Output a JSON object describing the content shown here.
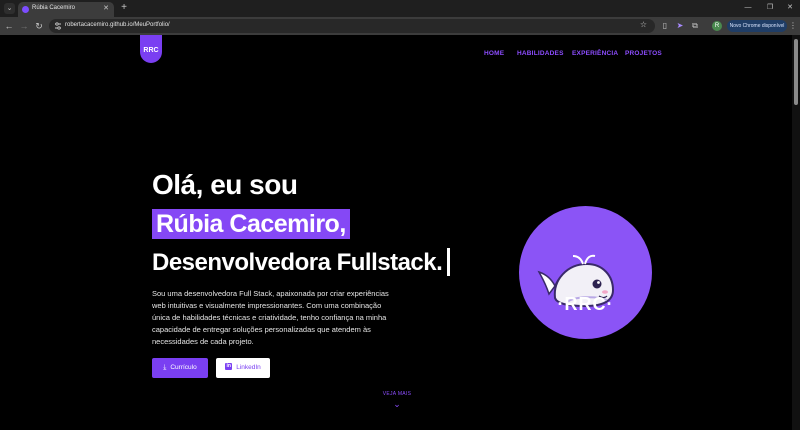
{
  "browser": {
    "tab_title": "Rúbia Cacemiro",
    "url": "robertacacemiro.github.io/MeuPortfolio/",
    "update_label": "Novo Chrome disponível",
    "profile_initial": "R"
  },
  "site": {
    "logo": "RRC",
    "nav": [
      "HOME",
      "HABILIDADES",
      "EXPERIÊNCIA",
      "PROJETOS"
    ],
    "greeting": "Olá, eu sou",
    "name": "Rúbia Cacemiro,",
    "role": "Desenvolvedora Fullstack.",
    "description": "Sou uma desenvolvedora Full Stack, apaixonada por criar experiências web intuitivas e visualmente impressionantes. Com uma combinação única de habilidades técnicas e criatividade, tenho confiança na minha capacidade de entregar soluções personalizadas que atendem às necessidades de cada projeto.",
    "buttons": {
      "resume": "Currículo",
      "linkedin": "LinkedIn"
    },
    "see_more": "VEJA MAIS",
    "avatar_text": "·RRC·"
  },
  "colors": {
    "accent": "#7a3ff2",
    "avatar_bg": "#8b54f6",
    "background": "#000000"
  }
}
